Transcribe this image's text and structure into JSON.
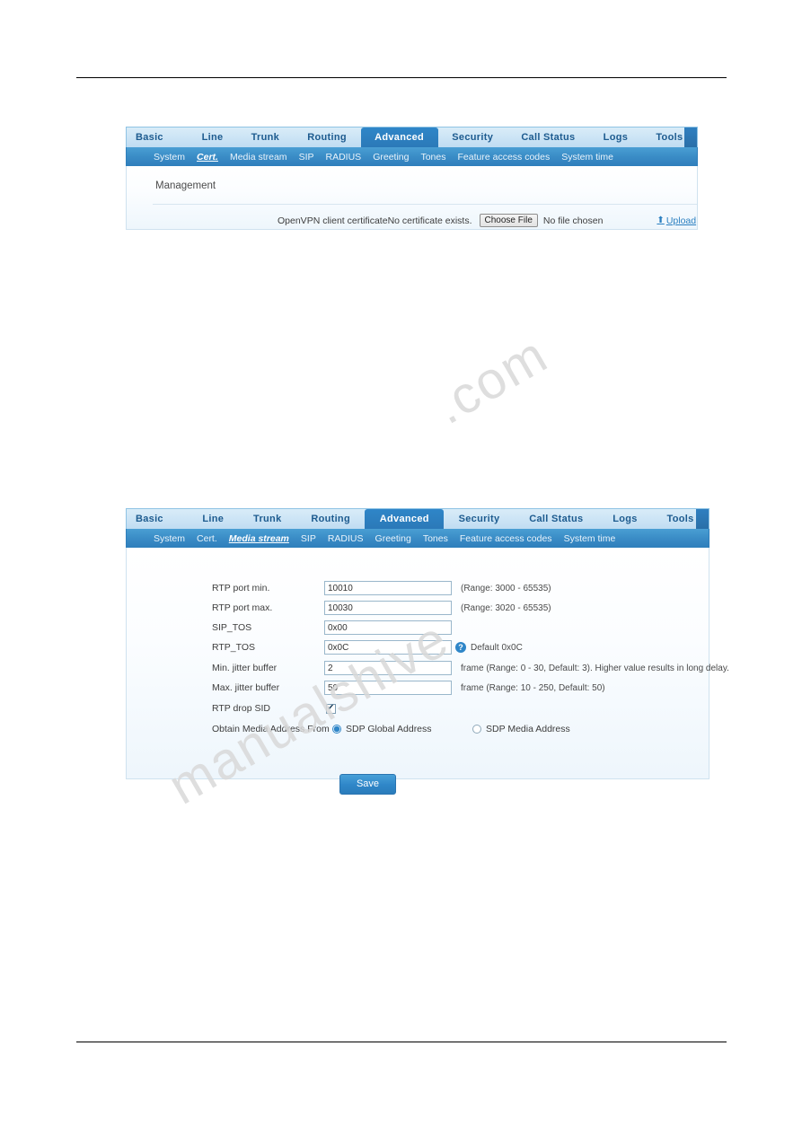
{
  "figure1": {
    "nav": [
      {
        "label": "Basic",
        "active": false
      },
      {
        "label": "Line",
        "active": false
      },
      {
        "label": "Trunk",
        "active": false
      },
      {
        "label": "Routing",
        "active": false
      },
      {
        "label": "Advanced",
        "active": true
      },
      {
        "label": "Security",
        "active": false
      },
      {
        "label": "Call Status",
        "active": false
      },
      {
        "label": "Logs",
        "active": false
      },
      {
        "label": "Tools",
        "active": false
      }
    ],
    "subnav": [
      {
        "label": "System",
        "active": false
      },
      {
        "label": "Cert.",
        "active": true
      },
      {
        "label": "Media stream",
        "active": false
      },
      {
        "label": "SIP",
        "active": false
      },
      {
        "label": "RADIUS",
        "active": false
      },
      {
        "label": "Greeting",
        "active": false
      },
      {
        "label": "Tones",
        "active": false
      },
      {
        "label": "Feature access codes",
        "active": false
      },
      {
        "label": "System time",
        "active": false
      }
    ],
    "section_title": "Management",
    "cert": {
      "label": "OpenVPN client certificate",
      "status": "No certificate exists.",
      "choose_file_button": "Choose File",
      "no_file_text": "No file chosen",
      "upload_link": "Upload",
      "upload_icon": "⬆"
    }
  },
  "figure2": {
    "nav": [
      {
        "label": "Basic",
        "active": false
      },
      {
        "label": "Line",
        "active": false
      },
      {
        "label": "Trunk",
        "active": false
      },
      {
        "label": "Routing",
        "active": false
      },
      {
        "label": "Advanced",
        "active": true
      },
      {
        "label": "Security",
        "active": false
      },
      {
        "label": "Call Status",
        "active": false
      },
      {
        "label": "Logs",
        "active": false
      },
      {
        "label": "Tools",
        "active": false
      }
    ],
    "subnav": [
      {
        "label": "System",
        "active": false
      },
      {
        "label": "Cert.",
        "active": false
      },
      {
        "label": "Media stream",
        "active": true
      },
      {
        "label": "SIP",
        "active": false
      },
      {
        "label": "RADIUS",
        "active": false
      },
      {
        "label": "Greeting",
        "active": false
      },
      {
        "label": "Tones",
        "active": false
      },
      {
        "label": "Feature access codes",
        "active": false
      },
      {
        "label": "System time",
        "active": false
      }
    ],
    "fields": {
      "rtp_port_min": {
        "label": "RTP port min.",
        "value": "10010",
        "hint": "(Range: 3000 - 65535)"
      },
      "rtp_port_max": {
        "label": "RTP port max.",
        "value": "10030",
        "hint": "(Range: 3020 - 65535)"
      },
      "sip_tos": {
        "label": "SIP_TOS",
        "value": "0x00",
        "hint": ""
      },
      "rtp_tos": {
        "label": "RTP_TOS",
        "value": "0x0C",
        "hint": "Default 0x0C",
        "help_icon": "?"
      },
      "min_jitter": {
        "label": "Min. jitter buffer",
        "value": "2",
        "hint": "frame (Range: 0 - 30, Default: 3). Higher value results in long delay."
      },
      "max_jitter": {
        "label": "Max. jitter buffer",
        "value": "50",
        "hint": "frame (Range: 10 - 250, Default: 50)"
      },
      "rtp_drop_sid": {
        "label": "RTP drop SID",
        "checked": true
      },
      "obtain_media": {
        "label": "Obtain Media Address From",
        "option1": "SDP Global Address",
        "option2": "SDP Media Address",
        "selected": "SDP Global Address"
      }
    },
    "save_button": "Save"
  },
  "watermark": {
    "line1": ".com",
    "line2": "manualshive"
  }
}
